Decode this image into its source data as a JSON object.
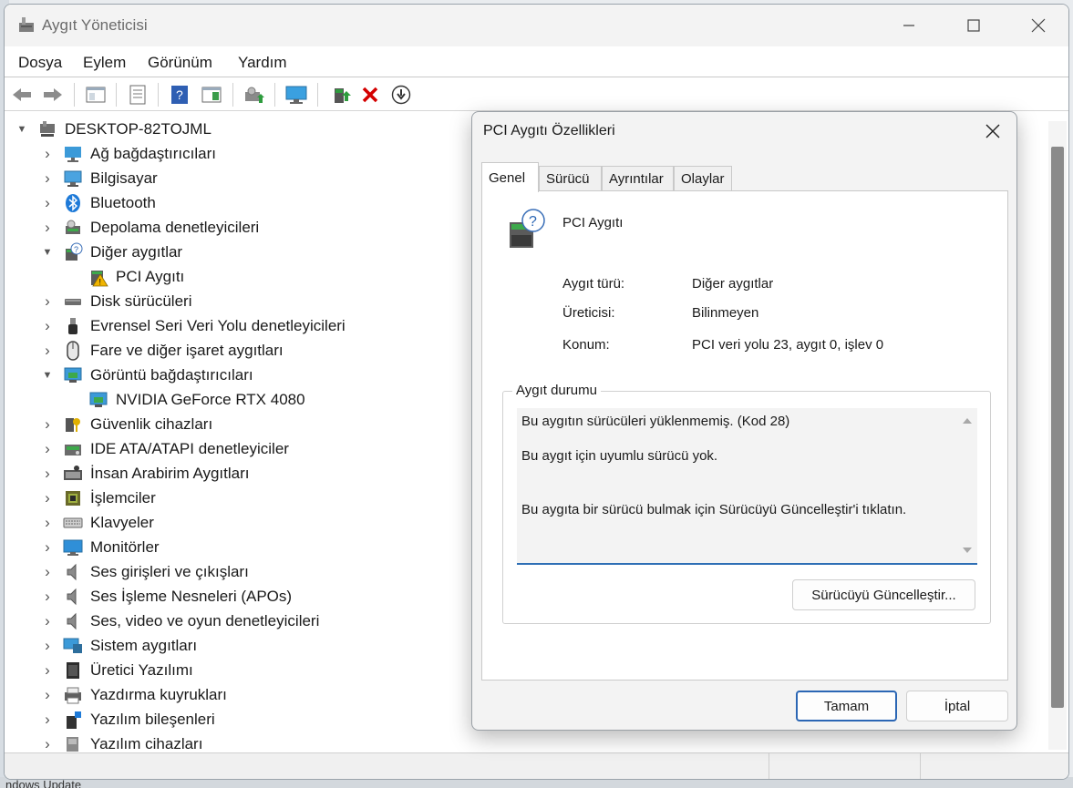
{
  "window": {
    "title": "Aygıt Yöneticisi"
  },
  "menu": [
    "Dosya",
    "Eylem",
    "Görünüm",
    "Yardım"
  ],
  "tree": {
    "root": "DESKTOP-82TOJML",
    "items": [
      {
        "label": "Ağ bağdaştırıcıları",
        "icon": "network-adapter-icon",
        "expanded": false
      },
      {
        "label": "Bilgisayar",
        "icon": "computer-icon",
        "expanded": false
      },
      {
        "label": "Bluetooth",
        "icon": "bluetooth-icon",
        "expanded": false
      },
      {
        "label": "Depolama denetleyicileri",
        "icon": "storage-controller-icon",
        "expanded": false
      },
      {
        "label": "Diğer aygıtlar",
        "icon": "other-devices-icon",
        "expanded": true
      },
      {
        "label": "PCI Aygıtı",
        "icon": "warning-device-icon",
        "child": true
      },
      {
        "label": "Disk sürücüleri",
        "icon": "disk-drive-icon",
        "expanded": false
      },
      {
        "label": "Evrensel Seri Veri Yolu denetleyicileri",
        "icon": "usb-icon",
        "expanded": false
      },
      {
        "label": "Fare ve diğer işaret aygıtları",
        "icon": "mouse-icon",
        "expanded": false
      },
      {
        "label": "Görüntü bağdaştırıcıları",
        "icon": "display-adapter-icon",
        "expanded": true
      },
      {
        "label": "NVIDIA GeForce RTX 4080",
        "icon": "display-adapter-icon",
        "child": true
      },
      {
        "label": "Güvenlik cihazları",
        "icon": "security-device-icon",
        "expanded": false
      },
      {
        "label": "IDE ATA/ATAPI denetleyiciler",
        "icon": "ide-controller-icon",
        "expanded": false
      },
      {
        "label": "İnsan Arabirim Aygıtları",
        "icon": "hid-icon",
        "expanded": false
      },
      {
        "label": "İşlemciler",
        "icon": "processor-icon",
        "expanded": false
      },
      {
        "label": "Klavyeler",
        "icon": "keyboard-icon",
        "expanded": false
      },
      {
        "label": "Monitörler",
        "icon": "monitor-icon",
        "expanded": false
      },
      {
        "label": "Ses girişleri ve çıkışları",
        "icon": "speaker-icon",
        "expanded": false
      },
      {
        "label": "Ses İşleme Nesneleri (APOs)",
        "icon": "speaker-icon",
        "expanded": false
      },
      {
        "label": "Ses, video ve oyun denetleyicileri",
        "icon": "speaker-icon",
        "expanded": false
      },
      {
        "label": "Sistem aygıtları",
        "icon": "system-device-icon",
        "expanded": false
      },
      {
        "label": "Üretici Yazılımı",
        "icon": "firmware-icon",
        "expanded": false
      },
      {
        "label": "Yazdırma kuyrukları",
        "icon": "printer-icon",
        "expanded": false
      },
      {
        "label": "Yazılım bileşenleri",
        "icon": "software-component-icon",
        "expanded": false
      },
      {
        "label": "Yazılım cihazları",
        "icon": "software-device-icon",
        "expanded": false
      }
    ]
  },
  "taskbar_text": "ndows Update",
  "dialog": {
    "title": "PCI Aygıtı Özellikleri",
    "tabs": [
      "Genel",
      "Sürücü",
      "Ayrıntılar",
      "Olaylar"
    ],
    "device_name": "PCI Aygıtı",
    "fields": [
      {
        "label": "Aygıt türü:",
        "value": "Diğer aygıtlar"
      },
      {
        "label": "Üreticisi:",
        "value": "Bilinmeyen"
      },
      {
        "label": "Konum:",
        "value": "PCI veri yolu 23, aygıt 0, işlev 0"
      }
    ],
    "status_group": "Aygıt durumu",
    "status_lines": [
      "Bu aygıtın sürücüleri yüklenmemiş. (Kod 28)",
      "Bu aygıt için uyumlu sürücü yok.",
      "Bu aygıta bir sürücü bulmak için Sürücüyü Güncelleştir'i tıklatın."
    ],
    "update_button": "Sürücüyü Güncelleştir...",
    "ok_button": "Tamam",
    "cancel_button": "İptal"
  },
  "colors": {
    "accent": "#2b66b4",
    "warning": "#f0b400",
    "error": "#d40000"
  }
}
